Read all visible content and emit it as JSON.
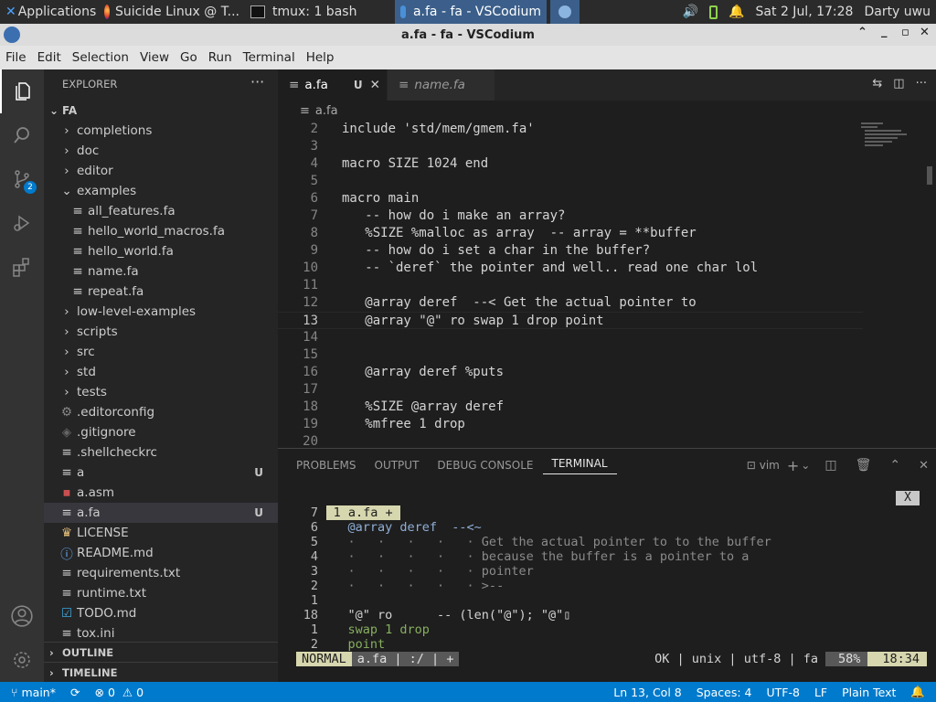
{
  "taskbar": {
    "apps": [
      "Applications ☰",
      "Suicide Linux @ T...",
      "tmux: 1 bash",
      "a.fa - fa - VSCodium"
    ],
    "clock": "Sat  2 Jul, 17:28",
    "user": "Darty uwu"
  },
  "window": {
    "title": "a.fa - fa - VSCodium"
  },
  "menu": [
    "File",
    "Edit",
    "Selection",
    "View",
    "Go",
    "Run",
    "Terminal",
    "Help"
  ],
  "activity": {
    "scm_badge": "2"
  },
  "explorer": {
    "title": "EXPLORER",
    "root": "FA",
    "items": [
      {
        "label": "completions",
        "indent": 1,
        "kind": "folder"
      },
      {
        "label": "doc",
        "indent": 1,
        "kind": "folder"
      },
      {
        "label": "editor",
        "indent": 1,
        "kind": "folder"
      },
      {
        "label": "examples",
        "indent": 1,
        "kind": "folder-open"
      },
      {
        "label": "all_features.fa",
        "indent": 2,
        "kind": "file"
      },
      {
        "label": "hello_world_macros.fa",
        "indent": 2,
        "kind": "file"
      },
      {
        "label": "hello_world.fa",
        "indent": 2,
        "kind": "file"
      },
      {
        "label": "name.fa",
        "indent": 2,
        "kind": "file"
      },
      {
        "label": "repeat.fa",
        "indent": 2,
        "kind": "file"
      },
      {
        "label": "low-level-examples",
        "indent": 1,
        "kind": "folder"
      },
      {
        "label": "scripts",
        "indent": 1,
        "kind": "folder"
      },
      {
        "label": "src",
        "indent": 1,
        "kind": "folder"
      },
      {
        "label": "std",
        "indent": 1,
        "kind": "folder"
      },
      {
        "label": "tests",
        "indent": 1,
        "kind": "folder"
      },
      {
        "label": ".editorconfig",
        "indent": 1,
        "kind": "gear"
      },
      {
        "label": ".gitignore",
        "indent": 1,
        "kind": "git"
      },
      {
        "label": ".shellcheckrc",
        "indent": 1,
        "kind": "file"
      },
      {
        "label": "a",
        "indent": 1,
        "kind": "file",
        "badge": "U"
      },
      {
        "label": "a.asm",
        "indent": 1,
        "kind": "asm"
      },
      {
        "label": "a.fa",
        "indent": 1,
        "kind": "file",
        "badge": "U",
        "selected": true
      },
      {
        "label": "LICENSE",
        "indent": 1,
        "kind": "license"
      },
      {
        "label": "README.md",
        "indent": 1,
        "kind": "info"
      },
      {
        "label": "requirements.txt",
        "indent": 1,
        "kind": "file"
      },
      {
        "label": "runtime.txt",
        "indent": 1,
        "kind": "file"
      },
      {
        "label": "TODO.md",
        "indent": 1,
        "kind": "todo"
      },
      {
        "label": "tox.ini",
        "indent": 1,
        "kind": "file"
      }
    ],
    "outline": "OUTLINE",
    "timeline": "TIMELINE"
  },
  "editor": {
    "tabs": [
      {
        "label": "a.fa",
        "badge": "U",
        "active": true
      },
      {
        "label": "name.fa",
        "badge": "",
        "active": false
      }
    ],
    "breadcrumb": "a.fa",
    "lines": [
      {
        "n": "2",
        "text": "include 'std/mem/gmem.fa'"
      },
      {
        "n": "3",
        "text": ""
      },
      {
        "n": "4",
        "text": "macro SIZE 1024 end"
      },
      {
        "n": "5",
        "text": ""
      },
      {
        "n": "6",
        "text": "macro main"
      },
      {
        "n": "7",
        "text": "   -- how do i make an array?"
      },
      {
        "n": "8",
        "text": "   %SIZE %malloc as array  -- array = **buffer"
      },
      {
        "n": "9",
        "text": "   -- how do i set a char in the buffer?"
      },
      {
        "n": "10",
        "text": "   -- `deref` the pointer and well.. read one char lol"
      },
      {
        "n": "11",
        "text": ""
      },
      {
        "n": "12",
        "text": "   @array deref  --< Get the actual pointer to"
      },
      {
        "n": "13",
        "text": "   @array \"@\" ro swap 1 drop point"
      },
      {
        "n": "14",
        "text": ""
      },
      {
        "n": "15",
        "text": ""
      },
      {
        "n": "16",
        "text": "   @array deref %puts"
      },
      {
        "n": "17",
        "text": ""
      },
      {
        "n": "18",
        "text": "   %SIZE @array deref"
      },
      {
        "n": "19",
        "text": "   %mfree 1 drop"
      },
      {
        "n": "20",
        "text": ""
      }
    ]
  },
  "panel": {
    "tabs": [
      "PROBLEMS",
      "OUTPUT",
      "DEBUG CONSOLE",
      "TERMINAL"
    ],
    "shell": "vim",
    "vim_tab": " 1 a.fa + ",
    "close_x": "X",
    "lines": [
      {
        "n": "7",
        "text": ""
      },
      {
        "n": "6",
        "text": "    @array deref  --<~"
      },
      {
        "n": "5",
        "text": "    ·   ·   ·   ·   · Get the actual pointer to to the buffer"
      },
      {
        "n": "4",
        "text": "    ·   ·   ·   ·   · because the buffer is a pointer to a"
      },
      {
        "n": "3",
        "text": "    ·   ·   ·   ·   · pointer"
      },
      {
        "n": "2",
        "text": "    ·   ·   ·   ·   · >--"
      },
      {
        "n": "1",
        "text": ""
      },
      {
        "n": "18",
        "text": "    \"@\" ro      -- (len(\"@\"); \"@\"▯"
      },
      {
        "n": "1",
        "text": "    swap 1 drop"
      },
      {
        "n": "2",
        "text": "    point"
      }
    ],
    "status": {
      "mode": "NORMAL",
      "file": "a.fa | :/ | +",
      "info": "OK | unix | utf-8 | fa",
      "pct": "58%",
      "pos": "18:34"
    }
  },
  "statusbar": {
    "branch": "main*",
    "errors": "0",
    "warnings": "0",
    "position": "Ln 13, Col 8",
    "spaces": "Spaces: 4",
    "encoding": "UTF-8",
    "eol": "LF",
    "lang": "Plain Text"
  }
}
